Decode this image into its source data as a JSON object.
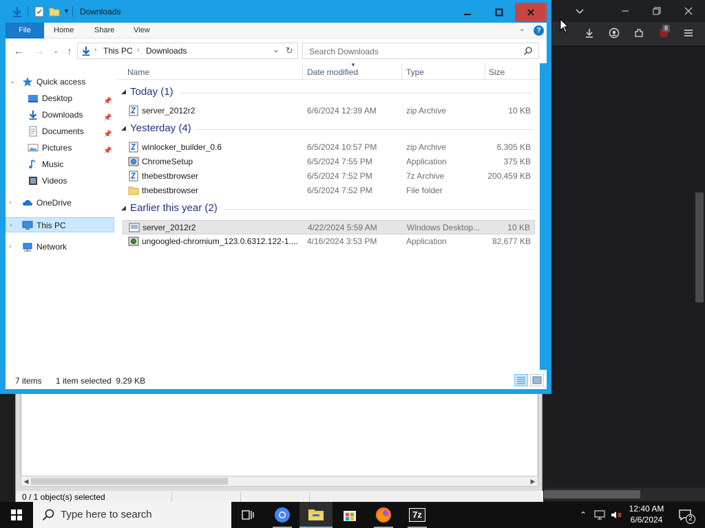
{
  "explorer": {
    "title": "Downloads",
    "ribbon": {
      "file": "File",
      "home": "Home",
      "share": "Share",
      "view": "View",
      "help": "?"
    },
    "address": {
      "crumb1": "This PC",
      "crumb2": "Downloads"
    },
    "search": {
      "placeholder": "Search Downloads"
    },
    "nav": {
      "quick_access": "Quick access",
      "desktop": "Desktop",
      "downloads": "Downloads",
      "documents": "Documents",
      "pictures": "Pictures",
      "music": "Music",
      "videos": "Videos",
      "onedrive": "OneDrive",
      "this_pc": "This PC",
      "network": "Network"
    },
    "columns": {
      "name": "Name",
      "date": "Date modified",
      "type": "Type",
      "size": "Size"
    },
    "groups": {
      "today": "Today (1)",
      "yesterday": "Yesterday (4)",
      "earlier": "Earlier this year (2)"
    },
    "files": [
      {
        "name": "server_2012r2",
        "date": "6/6/2024 12:39 AM",
        "type": "zip Archive",
        "size": "10 KB"
      },
      {
        "name": "winlocker_builder_0.6",
        "date": "6/5/2024 10:57 PM",
        "type": "zip Archive",
        "size": "6,305 KB"
      },
      {
        "name": "ChromeSetup",
        "date": "6/5/2024 7:55 PM",
        "type": "Application",
        "size": "375 KB"
      },
      {
        "name": "thebestbrowser",
        "date": "6/5/2024 7:52 PM",
        "type": "7z Archive",
        "size": "200,459 KB"
      },
      {
        "name": "thebestbrowser",
        "date": "6/5/2024 7:52 PM",
        "type": "File folder",
        "size": ""
      },
      {
        "name": "server_2012r2",
        "date": "4/22/2024 5:59 AM",
        "type": "Windows Desktop...",
        "size": "10 KB"
      },
      {
        "name": "ungoogled-chromium_123.0.6312.122-1....",
        "date": "4/16/2024 3:53 PM",
        "type": "Application",
        "size": "82,677 KB"
      }
    ],
    "status": {
      "items": "7 items",
      "selected": "1 item selected  9.29 KB"
    }
  },
  "zip_window": {
    "status": "0 / 1 object(s) selected"
  },
  "browser": {
    "badge": "8"
  },
  "taskbar": {
    "search_placeholder": "Type here to search",
    "time": "12:40 AM",
    "date": "6/6/2024",
    "notifications": "2",
    "sevenzip_label": "7z"
  },
  "colors": {
    "accent": "#1b9fe6",
    "file_tab": "#1979ca",
    "group_title": "#1e3287",
    "close": "#c94545"
  }
}
